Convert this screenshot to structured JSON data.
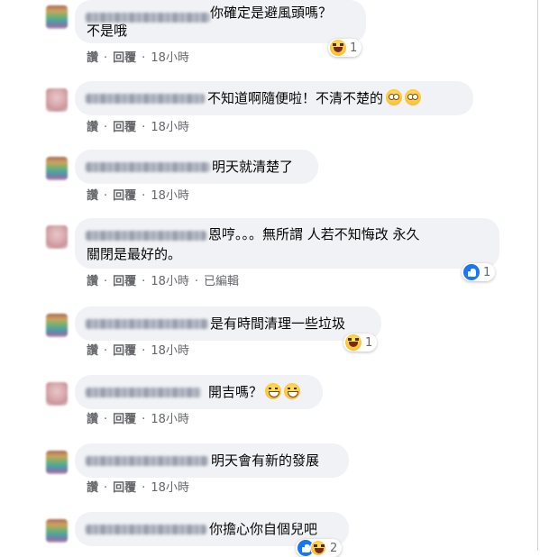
{
  "comments": [
    {
      "text_lines": [
        "你確定是避風頭嗎？",
        "不是哦"
      ],
      "avatar": "rainbow",
      "emojis": [],
      "actions": [
        "讚",
        "回覆",
        "18小時"
      ],
      "reaction": {
        "icons": [
          "haha"
        ],
        "count": "1"
      }
    },
    {
      "text_lines": [
        "不知道啊隨便啦！不清不楚的"
      ],
      "avatar": "pink",
      "emojis": [
        "flushed-face",
        "flushed-face"
      ],
      "actions": [
        "讚",
        "回覆",
        "18小時"
      ],
      "reaction": null
    },
    {
      "text_lines": [
        "明天就清楚了"
      ],
      "avatar": "rainbow",
      "emojis": [],
      "actions": [
        "讚",
        "回覆",
        "18小時"
      ],
      "reaction": null
    },
    {
      "text_lines": [
        "恩哼。。。無所謂 人若不知悔改 永久",
        "關閉是最好的。"
      ],
      "avatar": "pink",
      "emojis": [],
      "actions": [
        "讚",
        "回覆",
        "18小時",
        "已編輯"
      ],
      "reaction": {
        "icons": [
          "like"
        ],
        "count": "1"
      }
    },
    {
      "text_lines": [
        "是有時間清理一些垃圾"
      ],
      "avatar": "rainbow",
      "emojis": [],
      "actions": [
        "讚",
        "回覆",
        "18小時"
      ],
      "reaction": {
        "icons": [
          "haha"
        ],
        "count": "1"
      }
    },
    {
      "text_lines": [
        "開吉嗎？"
      ],
      "avatar": "pink",
      "emojis": [
        "grinning-face",
        "grinning-face"
      ],
      "actions": [
        "讚",
        "回覆",
        "18小時"
      ],
      "reaction": null
    },
    {
      "text_lines": [
        "明天會有新的發展"
      ],
      "avatar": "rainbow",
      "emojis": [],
      "actions": [
        "讚",
        "回覆",
        "18小時"
      ],
      "reaction": null
    },
    {
      "text_lines": [
        "你擔心你自個兒吧"
      ],
      "avatar": "rainbow",
      "emojis": [],
      "actions": [],
      "reaction": {
        "icons": [
          "like",
          "haha"
        ],
        "count": "2"
      }
    }
  ],
  "colors": {
    "bubble": "#f0f2f5",
    "text": "#050505",
    "meta": "#65676b",
    "like_blue": "#1877f2"
  }
}
